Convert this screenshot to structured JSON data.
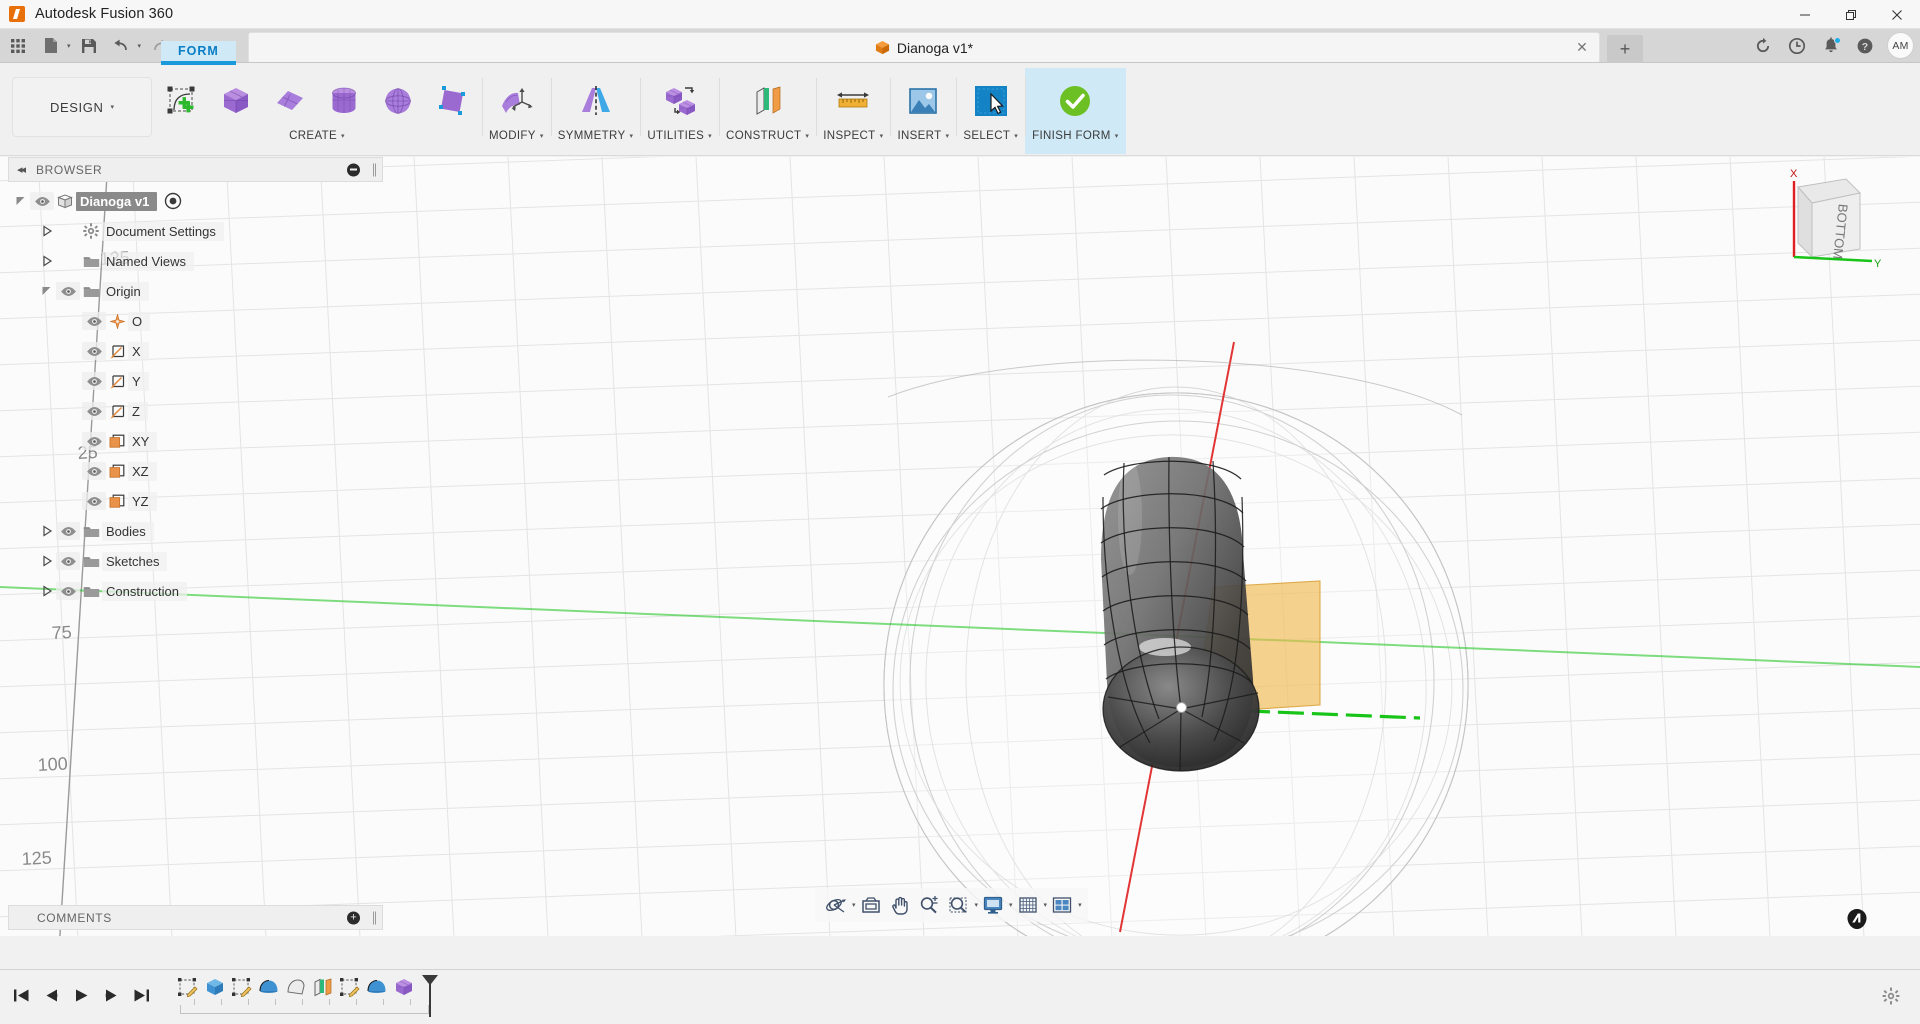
{
  "window": {
    "app_title": "Autodesk Fusion 360",
    "minimize": "—",
    "maximize": "❐",
    "close": "✕"
  },
  "quick_access": {
    "grid_icon": "app-grid-icon",
    "new_icon": "new-document-icon",
    "save_icon": "save-icon",
    "undo_icon": "undo-icon",
    "redo_icon": "redo-icon",
    "caret": "▾"
  },
  "document_tab": {
    "title": "Dianoga v1*",
    "close": "✕",
    "new_tab": "+"
  },
  "account_bar": {
    "refresh_icon": "refresh-job-status-icon",
    "history_icon": "recent-activity-clock-icon",
    "notifications_icon": "notifications-bell-icon",
    "help_icon": "help-question-icon",
    "avatar_initials": "AM"
  },
  "ribbon": {
    "workspace": "DESIGN",
    "workspace_caret": "▾",
    "active_tab": "FORM",
    "groups": [
      {
        "label": "CREATE",
        "caret": "▾",
        "highlight": false,
        "buttons": [
          {
            "name": "create-form-sketch-button"
          },
          {
            "name": "create-box-button"
          },
          {
            "name": "create-plane-button"
          },
          {
            "name": "create-cylinder-button"
          },
          {
            "name": "create-sphere-button"
          },
          {
            "name": "create-quadball-button"
          }
        ]
      },
      {
        "label": "MODIFY",
        "caret": "▾",
        "highlight": false,
        "buttons": [
          {
            "name": "modify-edit-form-button"
          }
        ]
      },
      {
        "label": "SYMMETRY",
        "caret": "▾",
        "highlight": false,
        "buttons": [
          {
            "name": "symmetry-mirror-internal-button"
          }
        ]
      },
      {
        "label": "UTILITIES",
        "caret": "▾",
        "highlight": false,
        "buttons": [
          {
            "name": "utilities-convert-button"
          }
        ]
      },
      {
        "label": "CONSTRUCT",
        "caret": "▾",
        "highlight": false,
        "buttons": [
          {
            "name": "construct-offset-plane-button"
          }
        ]
      },
      {
        "label": "INSPECT",
        "caret": "▾",
        "highlight": false,
        "buttons": [
          {
            "name": "inspect-measure-button"
          }
        ]
      },
      {
        "label": "INSERT",
        "caret": "▾",
        "highlight": false,
        "buttons": [
          {
            "name": "insert-canvas-button"
          }
        ]
      },
      {
        "label": "SELECT",
        "caret": "▾",
        "highlight": false,
        "buttons": [
          {
            "name": "select-tool-button"
          }
        ]
      },
      {
        "label": "FINISH FORM",
        "caret": "▾",
        "highlight": true,
        "buttons": [
          {
            "name": "finish-form-button"
          }
        ]
      }
    ]
  },
  "browser": {
    "title": "BROWSER",
    "collapse_icon": "◂◂",
    "tree": [
      {
        "label": "Dianoga v1",
        "indent": 0,
        "expander": "down",
        "eye": true,
        "icon": "component-icon",
        "selected": true,
        "target": true
      },
      {
        "label": "Document Settings",
        "indent": 1,
        "expander": "right",
        "eye": false,
        "icon": "gear-icon",
        "selected": false,
        "target": false
      },
      {
        "label": "Named Views",
        "indent": 1,
        "expander": "right",
        "eye": false,
        "icon": "folder-icon",
        "selected": false,
        "target": false
      },
      {
        "label": "Origin",
        "indent": 1,
        "expander": "down",
        "eye": true,
        "icon": "folder-icon",
        "selected": false,
        "target": false
      },
      {
        "label": "O",
        "indent": 2,
        "expander": "none",
        "eye": true,
        "icon": "origin-point-icon",
        "selected": false,
        "target": false
      },
      {
        "label": "X",
        "indent": 2,
        "expander": "none",
        "eye": true,
        "icon": "axis-icon",
        "selected": false,
        "target": false
      },
      {
        "label": "Y",
        "indent": 2,
        "expander": "none",
        "eye": true,
        "icon": "axis-icon",
        "selected": false,
        "target": false
      },
      {
        "label": "Z",
        "indent": 2,
        "expander": "none",
        "eye": true,
        "icon": "axis-icon",
        "selected": false,
        "target": false
      },
      {
        "label": "XY",
        "indent": 2,
        "expander": "none",
        "eye": true,
        "icon": "plane-icon",
        "selected": false,
        "target": false
      },
      {
        "label": "XZ",
        "indent": 2,
        "expander": "none",
        "eye": true,
        "icon": "plane-icon",
        "selected": false,
        "target": false
      },
      {
        "label": "YZ",
        "indent": 2,
        "expander": "none",
        "eye": true,
        "icon": "plane-icon",
        "selected": false,
        "target": false
      },
      {
        "label": "Bodies",
        "indent": 1,
        "expander": "right",
        "eye": true,
        "icon": "folder-icon",
        "selected": false,
        "target": false
      },
      {
        "label": "Sketches",
        "indent": 1,
        "expander": "right",
        "eye": true,
        "icon": "folder-icon",
        "selected": false,
        "target": false
      },
      {
        "label": "Construction",
        "indent": 1,
        "expander": "right",
        "eye": true,
        "icon": "folder-icon",
        "selected": false,
        "target": false
      }
    ]
  },
  "comments": {
    "title": "COMMENTS",
    "add": "+"
  },
  "canvas": {
    "grid_labels": [
      "125",
      "25",
      "75",
      "100",
      "125"
    ],
    "viewcube_face": "BOTTOM",
    "viewcube_x_label": "X",
    "viewcube_y_label": "Y",
    "axis_x_color": "#e02020",
    "axis_y_color": "#19c419",
    "plane_color": "#f0b74a",
    "body_color": "#5a5a5a"
  },
  "navbar": {
    "buttons": [
      {
        "name": "orbit-button",
        "caret": true
      },
      {
        "name": "look-at-button",
        "caret": false
      },
      {
        "name": "pan-button",
        "caret": false
      },
      {
        "name": "zoom-button",
        "caret": false
      },
      {
        "name": "zoom-window-button",
        "caret": true
      },
      {
        "name": "display-settings-button",
        "caret": true
      },
      {
        "name": "grid-and-snaps-button",
        "caret": true
      },
      {
        "name": "viewports-button",
        "caret": true
      }
    ]
  },
  "timeline": {
    "playback": [
      {
        "name": "go-to-beginning-button",
        "glyph": "first"
      },
      {
        "name": "step-back-button",
        "glyph": "prev"
      },
      {
        "name": "play-button",
        "glyph": "play"
      },
      {
        "name": "step-forward-button",
        "glyph": "next"
      },
      {
        "name": "go-to-end-button",
        "glyph": "last"
      }
    ],
    "features": [
      {
        "name": "timeline-feature-sketch-1",
        "type": "sketch"
      },
      {
        "name": "timeline-feature-extrude-1",
        "type": "extrude"
      },
      {
        "name": "timeline-feature-sketch-2",
        "type": "sketch"
      },
      {
        "name": "timeline-feature-revolve-1",
        "type": "revolve"
      },
      {
        "name": "timeline-feature-loft-1",
        "type": "loft"
      },
      {
        "name": "timeline-feature-plane-1",
        "type": "plane"
      },
      {
        "name": "timeline-feature-sketch-3",
        "type": "sketch"
      },
      {
        "name": "timeline-feature-revolve-2",
        "type": "revolve"
      },
      {
        "name": "timeline-feature-form-1",
        "type": "form"
      }
    ],
    "settings_icon": "timeline-settings-gear-icon"
  }
}
